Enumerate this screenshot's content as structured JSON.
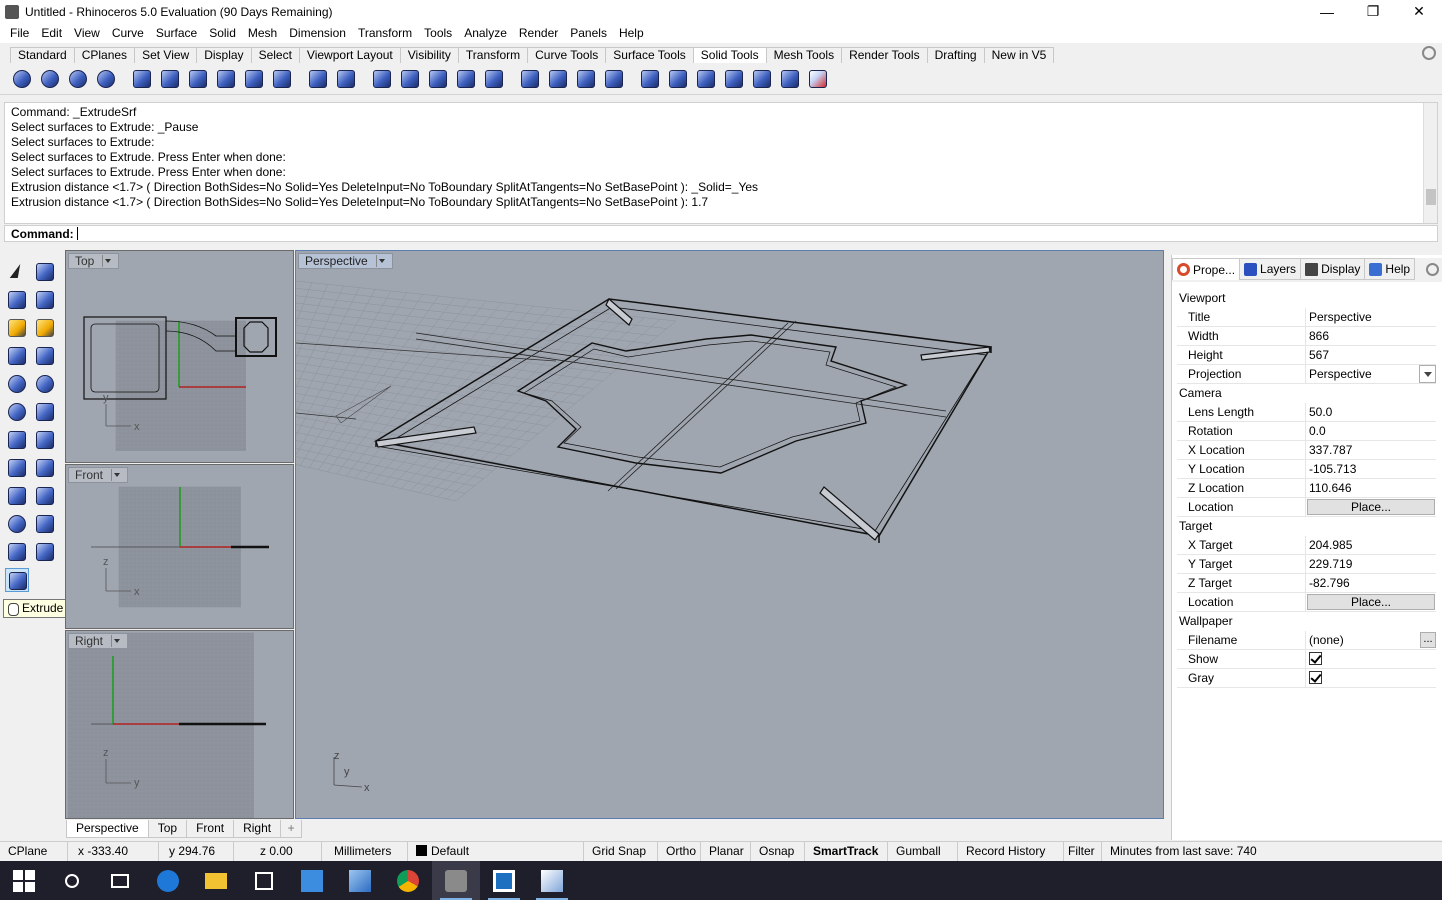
{
  "window": {
    "title": "Untitled - Rhinoceros 5.0 Evaluation (90 Days Remaining)",
    "minimize": "—",
    "maximize": "❐",
    "close": "✕"
  },
  "menu": [
    "File",
    "Edit",
    "View",
    "Curve",
    "Surface",
    "Solid",
    "Mesh",
    "Dimension",
    "Transform",
    "Tools",
    "Analyze",
    "Render",
    "Panels",
    "Help"
  ],
  "toolbar_tabs": [
    "Standard",
    "CPlanes",
    "Set View",
    "Display",
    "Select",
    "Viewport Layout",
    "Visibility",
    "Transform",
    "Curve Tools",
    "Surface Tools",
    "Solid Tools",
    "Mesh Tools",
    "Render Tools",
    "Drafting",
    "New in V5"
  ],
  "active_toolbar_tab": "Solid Tools",
  "command_history": [
    "Command: _ExtrudeSrf",
    "Select surfaces to Extrude: _Pause",
    "Select surfaces to Extrude:",
    "Select surfaces to Extrude. Press Enter when done:",
    "Select surfaces to Extrude. Press Enter when done:",
    "Extrusion distance <1.7> ( Direction  BothSides=No  Solid=Yes  DeleteInput=No  ToBoundary  SplitAtTangents=No  SetBasePoint ): _Solid=_Yes",
    "Extrusion distance <1.7> ( Direction  BothSides=No  Solid=Yes  DeleteInput=No  ToBoundary  SplitAtTangents=No  SetBasePoint ): 1.7"
  ],
  "command_prompt": "Command:",
  "tooltip": "Extrude surface",
  "viewports": {
    "top": "Top",
    "front": "Front",
    "right": "Right",
    "perspective": "Perspective"
  },
  "axis_labels": {
    "x": "x",
    "y": "y",
    "z": "z"
  },
  "viewport_tabs": [
    "Perspective",
    "Top",
    "Front",
    "Right"
  ],
  "viewport_tab_add": "+",
  "panel_tabs": [
    {
      "label": "Prope...",
      "icon": "properties-icon",
      "color": "#d84a2b"
    },
    {
      "label": "Layers",
      "icon": "layers-icon",
      "color": "#2b4fbf"
    },
    {
      "label": "Display",
      "icon": "display-icon",
      "color": "#444444"
    },
    {
      "label": "Help",
      "icon": "help-icon",
      "color": "#3a6fd1"
    }
  ],
  "properties": {
    "viewport_section": "Viewport",
    "title_k": "Title",
    "title_v": "Perspective",
    "width_k": "Width",
    "width_v": "866",
    "height_k": "Height",
    "height_v": "567",
    "projection_k": "Projection",
    "projection_v": "Perspective",
    "camera_section": "Camera",
    "lens_k": "Lens Length",
    "lens_v": "50.0",
    "rotation_k": "Rotation",
    "rotation_v": "0.0",
    "xloc_k": "X Location",
    "xloc_v": "337.787",
    "yloc_k": "Y Location",
    "yloc_v": "-105.713",
    "zloc_k": "Z Location",
    "zloc_v": "110.646",
    "loc_k": "Location",
    "place_btn": "Place...",
    "target_section": "Target",
    "xt_k": "X Target",
    "xt_v": "204.985",
    "yt_k": "Y Target",
    "yt_v": "229.719",
    "zt_k": "Z Target",
    "zt_v": "-82.796",
    "tloc_k": "Location",
    "wallpaper_section": "Wallpaper",
    "filename_k": "Filename",
    "filename_v": "(none)",
    "dots": "...",
    "show_k": "Show",
    "gray_k": "Gray"
  },
  "status": {
    "cplane": "CPlane",
    "x": "x -333.40",
    "y": "y 294.76",
    "z": "z 0.00",
    "units": "Millimeters",
    "layer": "Default",
    "grid_snap": "Grid Snap",
    "ortho": "Ortho",
    "planar": "Planar",
    "osnap": "Osnap",
    "smarttrack": "SmartTrack",
    "gumball": "Gumball",
    "record_history": "Record History",
    "filter": "Filter",
    "minutes": "Minutes from last save: 740"
  },
  "colors": {
    "viewport_bg": "#a0a6b0",
    "x_axis": "#b22222",
    "y_axis": "#1a9e1a",
    "accent": "#5b9bd5"
  }
}
